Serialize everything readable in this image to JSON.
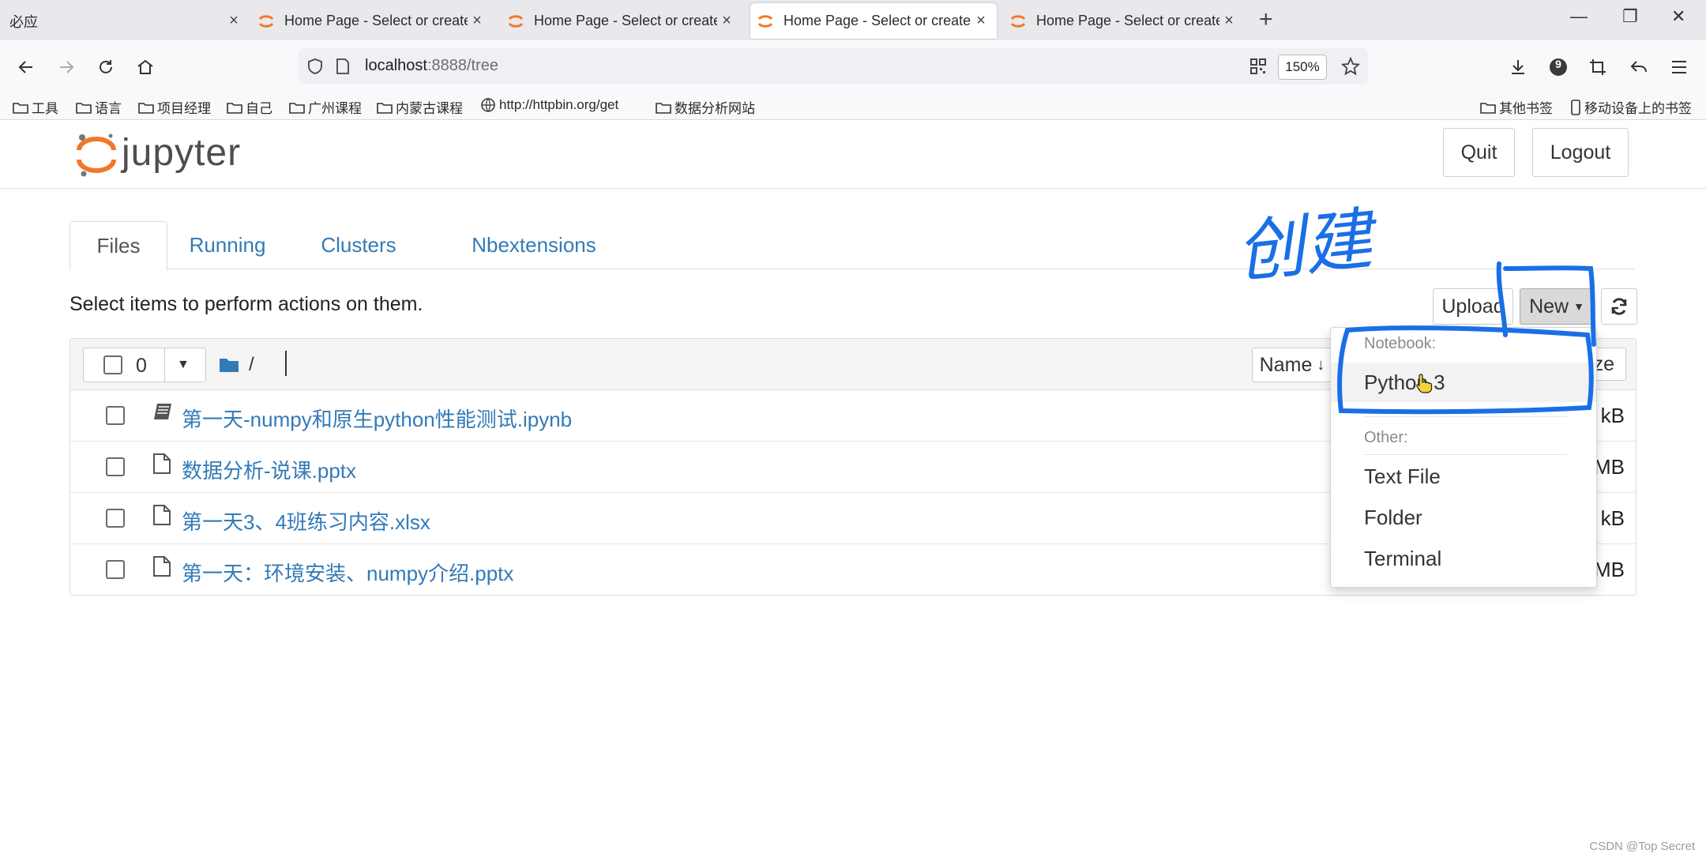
{
  "browser": {
    "tabs": [
      {
        "title": "必应"
      },
      {
        "title": "Home Page - Select or create a notebook"
      },
      {
        "title": "Home Page - Select or create a notebook"
      },
      {
        "title": "Home Page - Select or create a notebook"
      },
      {
        "title": "Home Page - Select or create a notebook"
      }
    ],
    "active_tab_index": 3,
    "url_host": "localhost",
    "url_rest": ":8888/tree",
    "zoom": "150%",
    "extension_badge": "9",
    "bookmarks": [
      "工具",
      "语言",
      "项目经理",
      "自己",
      "广州课程",
      "内蒙古课程",
      "http://httpbin.org/get",
      "数据分析网站"
    ],
    "bookmarks_right": [
      "其他书签",
      "移动设备上的书签"
    ]
  },
  "jupyter": {
    "logo_text": "jupyter",
    "quit_label": "Quit",
    "logout_label": "Logout",
    "tabs": [
      "Files",
      "Running",
      "Clusters",
      "Nbextensions"
    ],
    "active_tab": "Files",
    "instructions": "Select items to perform actions on them.",
    "upload_label": "Upload",
    "new_label": "New",
    "selected_count": "0",
    "breadcrumb": "/",
    "sort_label": "Name",
    "size_col_fragment": "ze",
    "files": [
      {
        "name": "第一天-numpy和原生python性能测试.ipynb",
        "type": "notebook",
        "size_fragment": "kB"
      },
      {
        "name": "数据分析-说课.pptx",
        "type": "file",
        "size_fragment": "MB"
      },
      {
        "name": "第一天3、4班练习内容.xlsx",
        "type": "file",
        "size_fragment": "kB"
      },
      {
        "name": "第一天：环境安装、numpy介绍.pptx",
        "type": "file",
        "size_fragment": "MB"
      }
    ],
    "new_menu": {
      "notebook_header": "Notebook:",
      "notebook_items": [
        "Python 3"
      ],
      "other_header": "Other:",
      "other_items": [
        "Text File",
        "Folder",
        "Terminal"
      ]
    }
  },
  "annotation": {
    "handwritten_text": "创建",
    "color": "#1a6fe6"
  },
  "watermark": "CSDN @Top Secret",
  "colors": {
    "link": "#337ab7",
    "jupyter_orange": "#f37726",
    "tab_strip": "#e9e9ed"
  }
}
